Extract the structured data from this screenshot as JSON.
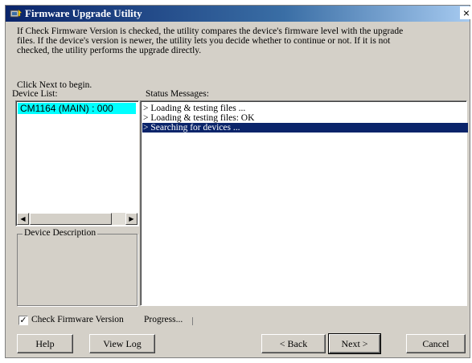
{
  "window": {
    "title": "Firmware Upgrade Utility",
    "close_glyph": "×"
  },
  "description": [
    "If Check Firmware Version is checked, the utility compares the device's firmware level with the upgrade",
    "files. If the device's version is newer, the utility lets you decide whether to continue or not. If it is not",
    "checked, the utility performs the upgrade directly."
  ],
  "prompt": "Click Next to begin.",
  "device_list": {
    "label": "Device List:",
    "items": [
      "CM1164 (MAIN) : 000"
    ]
  },
  "device_description": {
    "label": "Device Description",
    "text": ""
  },
  "status": {
    "label": "Status Messages:",
    "messages": [
      "> Loading & testing files ...",
      "> Loading & testing files: OK",
      "> Searching for devices ..."
    ],
    "selected_index": 2
  },
  "options": {
    "check_firmware_label": "Check Firmware Version",
    "check_firmware_checked": true,
    "check_mark": "✓"
  },
  "progress": {
    "label": "Progress...",
    "value": 0
  },
  "buttons": {
    "help": "Help",
    "view_log": "View Log",
    "back": "< Back",
    "next": "Next >",
    "cancel": "Cancel"
  },
  "icons": {
    "scroll_left": "◀",
    "scroll_right": "▶",
    "app_icon": "firmware-utility-icon"
  },
  "colors": {
    "title_start": "#0a246a",
    "selection": "#0a246a",
    "device_highlight": "#00ffff"
  }
}
